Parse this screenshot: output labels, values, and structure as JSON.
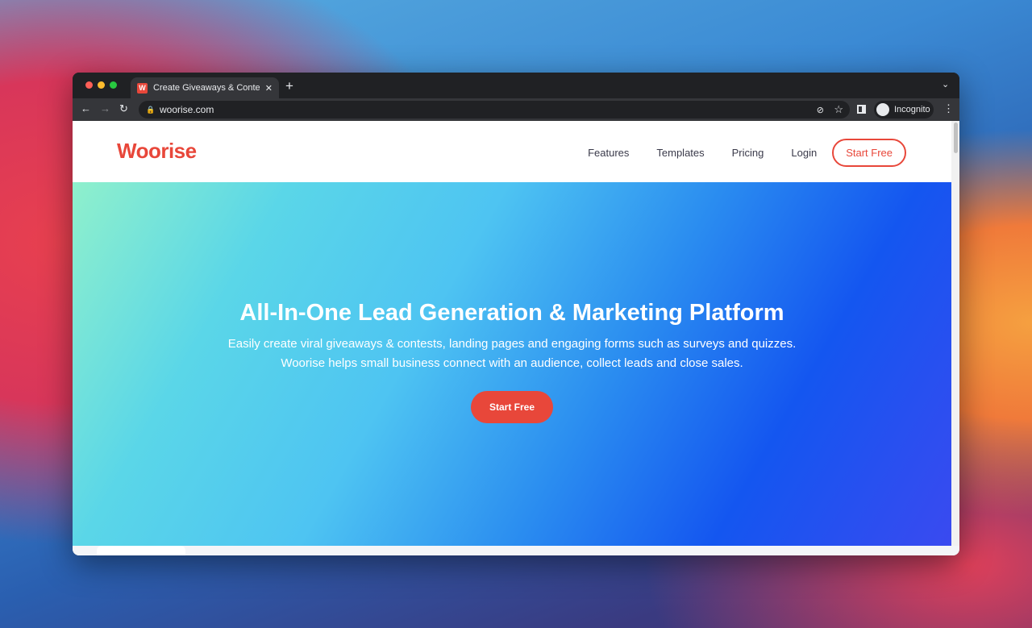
{
  "browser": {
    "tab_title": "Create Giveaways & Contests,",
    "favicon": "W",
    "url": "woorise.com",
    "profile": "Incognito",
    "icons": [
      "close-icon",
      "new-tab-icon",
      "tab-list-chevron-icon",
      "back-icon",
      "forward-icon",
      "reload-icon",
      "lock-icon",
      "eye-off-icon",
      "star-icon",
      "side-panel-icon",
      "incognito-icon",
      "menu-dots-icon"
    ]
  },
  "site": {
    "logo": "Woorise",
    "nav": [
      {
        "label": "Features"
      },
      {
        "label": "Templates"
      },
      {
        "label": "Pricing"
      },
      {
        "label": "Login"
      }
    ],
    "nav_cta": "Start Free",
    "hero": {
      "title": "All-In-One Lead Generation & Marketing Platform",
      "line1": "Easily create viral giveaways & contests, landing pages and engaging forms such as surveys and quizzes.",
      "line2": "Woorise helps small business connect with an audience, collect leads and close sales.",
      "cta": "Start Free"
    }
  },
  "colors": {
    "brand": "#e8473a"
  }
}
